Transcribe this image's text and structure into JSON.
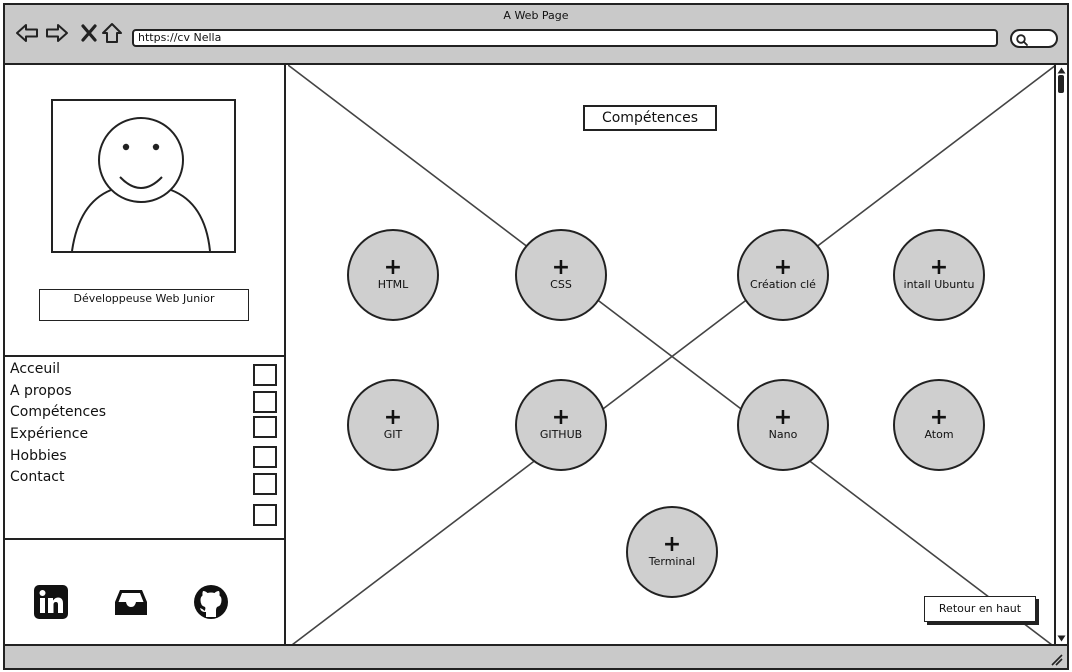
{
  "window": {
    "title": "A Web Page"
  },
  "browser": {
    "url": "https://cv Nella",
    "icons": [
      "back-arrow-icon",
      "forward-arrow-icon",
      "close-icon",
      "home-icon",
      "search-icon"
    ]
  },
  "profile": {
    "role": "Développeuse Web Junior",
    "avatar_icon": "person-placeholder-icon"
  },
  "menu": {
    "items": [
      {
        "label": "Acceuil"
      },
      {
        "label": "A propos"
      },
      {
        "label": "Compétences"
      },
      {
        "label": "Expérience"
      },
      {
        "label": "Hobbies"
      },
      {
        "label": "Contact"
      }
    ],
    "checkbox_count": 6
  },
  "social": {
    "icons": [
      "linkedin-icon",
      "inbox-icon",
      "github-icon"
    ]
  },
  "section": {
    "title": "Compétences",
    "skills": [
      {
        "label": "HTML"
      },
      {
        "label": "CSS"
      },
      {
        "label": "Création clé"
      },
      {
        "label": "intall Ubuntu"
      },
      {
        "label": "GIT"
      },
      {
        "label": "GITHUB"
      },
      {
        "label": "Nano"
      },
      {
        "label": "Atom"
      },
      {
        "label": "Terminal"
      }
    ],
    "skill_icon": "plus-icon"
  },
  "back_to_top": "Retour en haut",
  "colors": {
    "chrome": "#c9c9c9",
    "circle": "#cfcfcf",
    "line": "#222222"
  }
}
